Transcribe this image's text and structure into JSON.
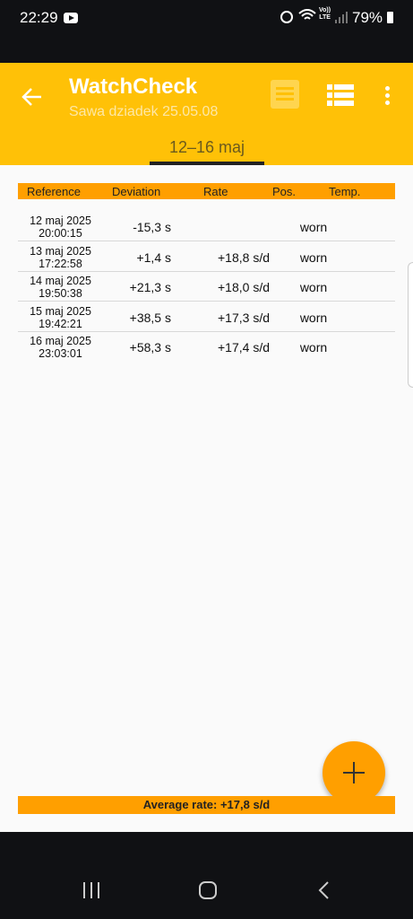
{
  "status": {
    "time": "22:29",
    "volte_top": "Vo))",
    "volte_bottom": "LTE",
    "battery": "79%"
  },
  "header": {
    "title": "WatchCheck",
    "subtitle": "Sawa dziadek 25.05.08",
    "tab": "12–16 maj"
  },
  "table": {
    "columns": [
      "Reference",
      "Deviation",
      "Rate",
      "Pos.",
      "Temp."
    ],
    "rows": [
      {
        "date": "12 maj 2025",
        "time": "20:00:15",
        "deviation": "-15,3 s",
        "rate": "",
        "position": "worn"
      },
      {
        "date": "13 maj 2025",
        "time": "17:22:58",
        "deviation": "+1,4 s",
        "rate": "+18,8 s/d",
        "position": "worn"
      },
      {
        "date": "14 maj 2025",
        "time": "19:50:38",
        "deviation": "+21,3 s",
        "rate": "+18,0 s/d",
        "position": "worn"
      },
      {
        "date": "15 maj 2025",
        "time": "19:42:21",
        "deviation": "+38,5 s",
        "rate": "+17,3 s/d",
        "position": "worn"
      },
      {
        "date": "16 maj 2025",
        "time": "23:03:01",
        "deviation": "+58,3 s",
        "rate": "+17,4 s/d",
        "position": "worn"
      }
    ]
  },
  "footer": {
    "average": "Average rate: +17,8 s/d"
  },
  "colors": {
    "accent": "#ffc107",
    "table_header": "#ff9f00",
    "fab": "#ff9f00"
  },
  "icons": [
    "youtube-icon",
    "alarm-icon",
    "wifi-icon",
    "signal-icon",
    "battery-icon",
    "back-arrow-icon",
    "chart-view-icon",
    "list-view-icon",
    "more-vert-icon",
    "add-icon",
    "recents-icon",
    "home-icon",
    "nav-back-icon"
  ]
}
